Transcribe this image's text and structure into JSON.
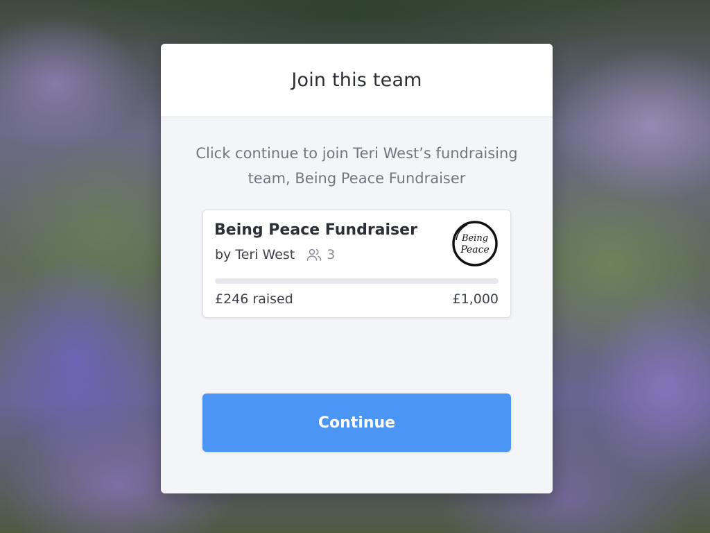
{
  "modal": {
    "title": "Join this team",
    "description": "Click continue to join Teri West’s fundraising team, Being Peace Fundraiser"
  },
  "team": {
    "name": "Being Peace Fundraiser",
    "owner": "by Teri West",
    "member_count": "3",
    "members_icon": "people-icon",
    "logo_icon": "being-peace-logo",
    "raised": "£246 raised",
    "goal": "£1,000",
    "progress_fraction": 0.0,
    "logo_text": "Being Peace"
  },
  "actions": {
    "continue_label": "Continue"
  },
  "colors": {
    "accent": "#4b96f5",
    "modal_bg": "#f4f5f8",
    "track": "#e7e8ee"
  }
}
